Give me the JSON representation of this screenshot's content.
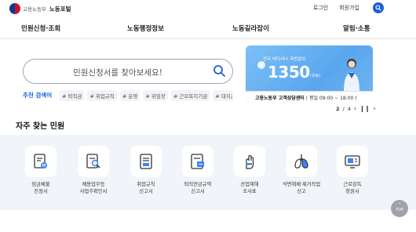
{
  "header": {
    "ministry": "고용노동부",
    "portal": "노동포털",
    "login": "로그인",
    "join": "회원가입"
  },
  "nav": [
    "민원신청·조회",
    "노동행정정보",
    "노동길라잡이",
    "알림·소통"
  ],
  "search": {
    "placeholder": "민원신청서를 찾아보세요!",
    "recommend_label": "추천 검색어",
    "tags": [
      "# 퇴직금",
      "# 취업규칙",
      "# 운영",
      "# 위임장",
      "# 근로복지기금",
      "# 대지급금"
    ]
  },
  "banner": {
    "kicker": "전국 어디서나 국번없이",
    "number": "1350",
    "unit": "(유료)",
    "footer_name": "고용노동부 고객상담센터",
    "footer_hours": "( 평일 09:00 ~ 18:00 )"
  },
  "pager": {
    "current": "2",
    "total": "4"
  },
  "frequent": {
    "title": "자주 찾는 민원",
    "items": [
      {
        "label": "임금체불\n진정서",
        "icon": "wage-document-icon"
      },
      {
        "label": "채용업무등\n사업주확인서",
        "icon": "search-document-icon"
      },
      {
        "label": "취업규칙\n신고서",
        "icon": "rules-document-icon"
      },
      {
        "label": "퇴직연금규약\n신고서",
        "icon": "pension-document-icon"
      },
      {
        "label": "산업재해\n조사표",
        "icon": "accident-hand-icon"
      },
      {
        "label": "석면해체·제거작업\n신고",
        "icon": "lungs-icon"
      },
      {
        "label": "근로감독\n청원서",
        "icon": "monitor-icon"
      }
    ]
  },
  "top_button": "TOP",
  "colors": {
    "accent": "#1a5fd6",
    "banner": "#6fb5f1",
    "band": "#f1f4f8"
  }
}
